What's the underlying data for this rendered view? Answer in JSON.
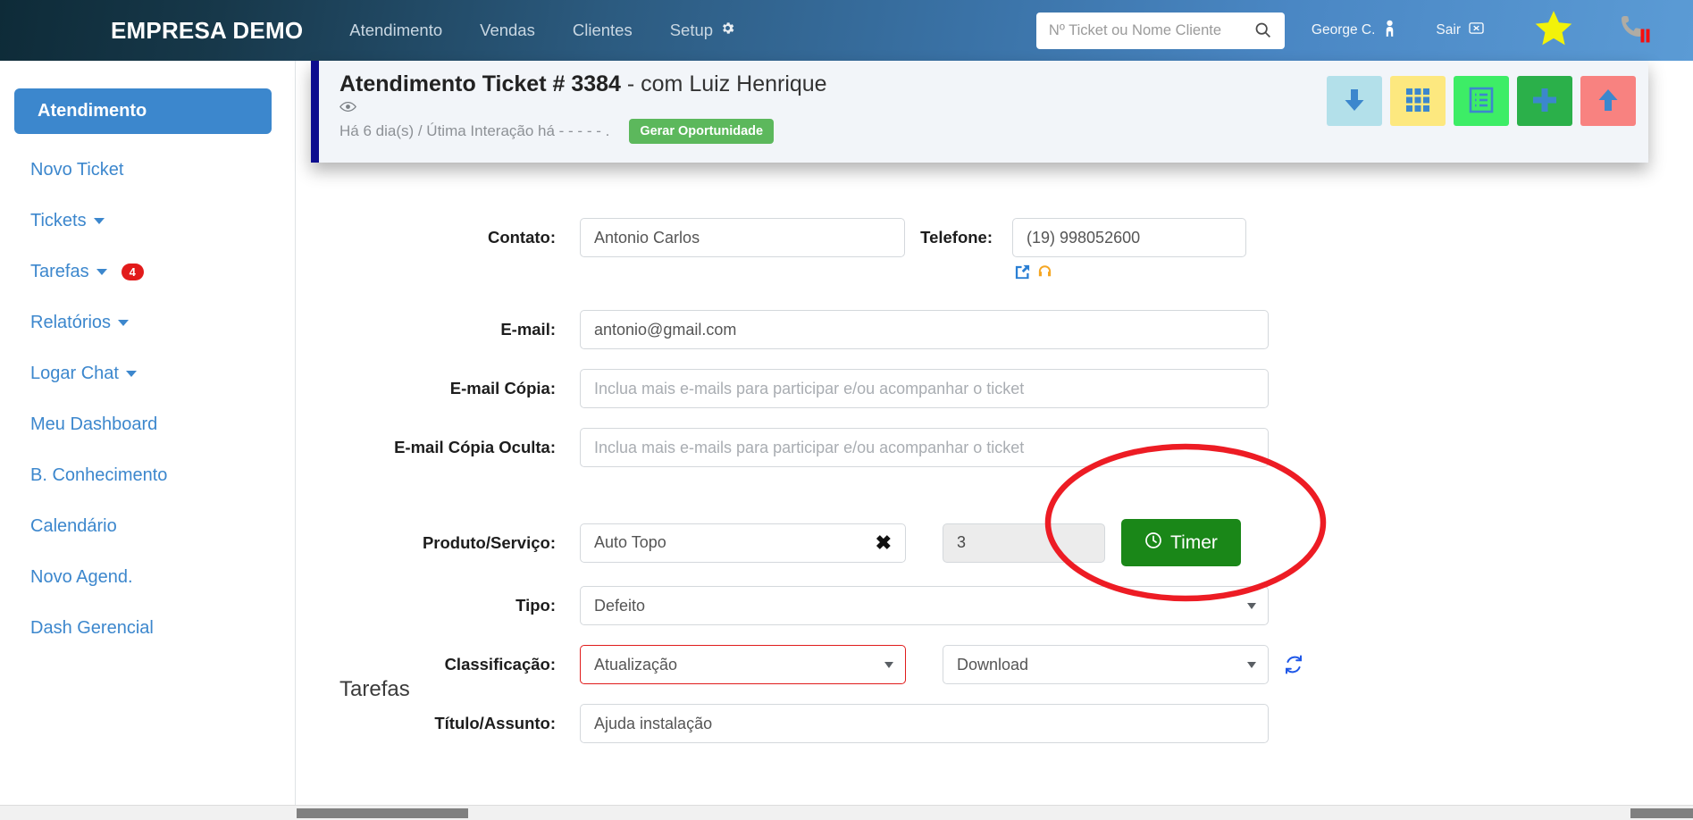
{
  "navbar": {
    "brand": "EMPRESA DEMO",
    "links": [
      {
        "label": "Atendimento",
        "icon": ""
      },
      {
        "label": "Vendas",
        "icon": ""
      },
      {
        "label": "Clientes",
        "icon": ""
      },
      {
        "label": "Setup",
        "icon": "gear-icon"
      }
    ],
    "search": {
      "placeholder": "Nº Ticket ou Nome Cliente",
      "value": "",
      "icon": "search-icon"
    },
    "user": {
      "label": "George C.",
      "icon": "user-icon"
    },
    "logout": {
      "label": "Sair",
      "icon": "logout-icon"
    },
    "star": {
      "icon": "star-icon"
    },
    "phone": {
      "icon": "phone-paused-icon"
    },
    "colors": {
      "gradient_start": "#0e2b38",
      "gradient_end": "#5b9bd5"
    }
  },
  "sidebar": {
    "items": [
      {
        "label": "Atendimento",
        "active": true,
        "caret": false,
        "badge": ""
      },
      {
        "label": "Novo Ticket",
        "active": false,
        "caret": false,
        "badge": ""
      },
      {
        "label": "Tickets",
        "active": false,
        "caret": true,
        "badge": ""
      },
      {
        "label": "Tarefas",
        "active": false,
        "caret": true,
        "badge": "4"
      },
      {
        "label": "Relatórios",
        "active": false,
        "caret": true,
        "badge": ""
      },
      {
        "label": "Logar Chat",
        "active": false,
        "caret": true,
        "badge": ""
      },
      {
        "label": "Meu Dashboard",
        "active": false,
        "caret": false,
        "badge": ""
      },
      {
        "label": "B. Conhecimento",
        "active": false,
        "caret": false,
        "badge": ""
      },
      {
        "label": "Calendário",
        "active": false,
        "caret": false,
        "badge": ""
      },
      {
        "label": "Novo Agend.",
        "active": false,
        "caret": false,
        "badge": ""
      },
      {
        "label": "Dash Gerencial",
        "active": false,
        "caret": false,
        "badge": ""
      }
    ],
    "active_color": "#3c87cd",
    "link_color": "#3c87cd",
    "badge_color": "#e21b1b"
  },
  "ticket_header": {
    "title_bold": "Atendimento Ticket # 3384",
    "title_rest": " - com Luiz Henrique",
    "eye_icon": "eye-icon",
    "meta": "Há 6 dia(s) / Útima Interação há - - - - - .",
    "opportunity_button": "Gerar Oportunidade",
    "accent_color": "#0d0d8f",
    "actions": [
      {
        "name": "download-button",
        "icon": "arrow-down-icon",
        "bg": "#b3e0ea",
        "fg": "#3c87cd"
      },
      {
        "name": "grid-button",
        "icon": "grid-icon",
        "bg": "#fde87f",
        "fg": "#3c87cd"
      },
      {
        "name": "form-list-button",
        "icon": "list-form-icon",
        "bg": "#3ded66",
        "fg": "#3c87cd"
      },
      {
        "name": "add-button",
        "icon": "plus-icon",
        "bg": "#2bb04a",
        "fg": "#3c87cd"
      },
      {
        "name": "upload-button",
        "icon": "arrow-up-icon",
        "bg": "#f88280",
        "fg": "#3c87cd"
      }
    ]
  },
  "form": {
    "contato": {
      "label": "Contato:",
      "value": "Antonio Carlos",
      "placeholder": ""
    },
    "telefone": {
      "label": "Telefone:",
      "value": "(19) 998052600",
      "placeholder": "",
      "icons": [
        "external-link-icon",
        "headset-icon"
      ]
    },
    "email": {
      "label": "E-mail:",
      "value": "antonio@gmail.com",
      "placeholder": ""
    },
    "email_copia": {
      "label": "E-mail Cópia:",
      "value": "",
      "placeholder": "Inclua mais e-mails para participar e/ou acompanhar o ticket"
    },
    "email_copia_oculta": {
      "label": "E-mail Cópia Oculta:",
      "value": "",
      "placeholder": "Inclua mais e-mails para participar e/ou acompanhar o ticket"
    },
    "produto": {
      "label": "Produto/Serviço:",
      "value": "Auto Topo",
      "placeholder": "",
      "clear_icon": "clear-x-icon"
    },
    "quantidade": {
      "value": "3",
      "placeholder": "",
      "disabled": true
    },
    "timer_button": {
      "label": "Timer",
      "icon": "clock-icon",
      "color": "#1a8718"
    },
    "tipo": {
      "label": "Tipo:",
      "value": "Defeito",
      "placeholder": ""
    },
    "classificacao": {
      "label": "Classificação:",
      "value": "Atualização",
      "placeholder": "",
      "error": true,
      "error_color": "#e01b1b"
    },
    "classificacao2": {
      "value": "Download",
      "placeholder": ""
    },
    "refresh_icon": "refresh-icon",
    "titulo": {
      "label": "Título/Assunto:",
      "value": "Ajuda instalação",
      "placeholder": ""
    }
  },
  "sections": {
    "tarefas_title": "Tarefas"
  },
  "annotation": {
    "shape": "ellipse",
    "color": "#ed1c24"
  }
}
